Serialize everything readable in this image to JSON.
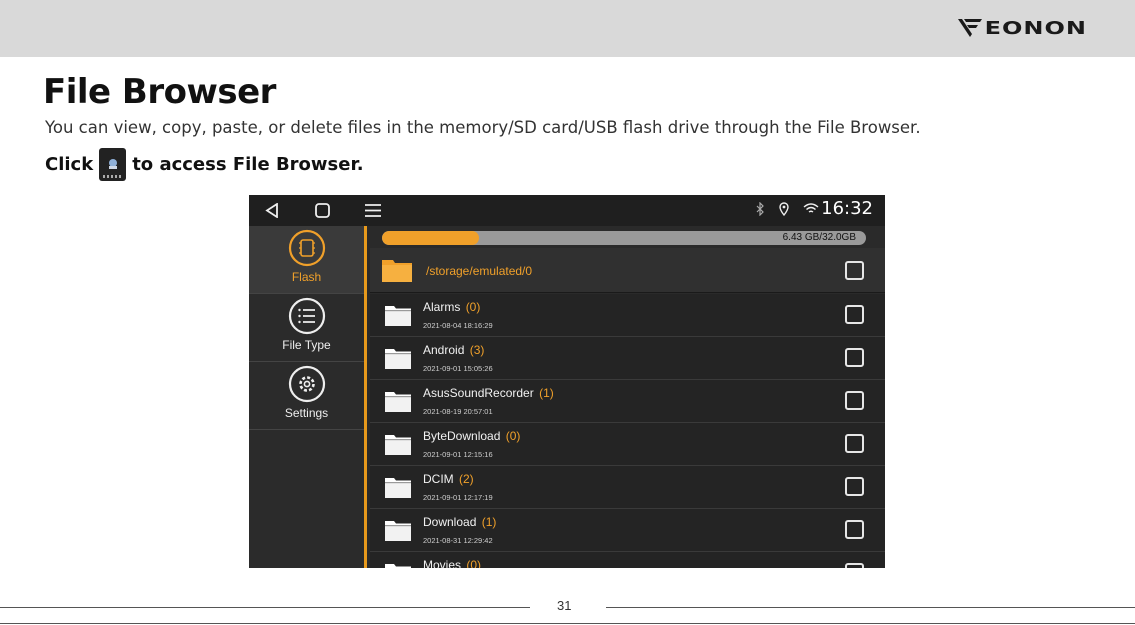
{
  "brand": {
    "name": "EONON",
    "logo_icon": "eonon-v-logo"
  },
  "document": {
    "title": "File Browser",
    "intro": "You can view, copy, paste, or delete files in the memory/SD card/USB flash drive through the File Browser.",
    "instruction_prefix": "Click",
    "instruction_suffix": "to access File Browser.",
    "instruction_icon": "file-browser-app-icon",
    "page_number": "31"
  },
  "screen": {
    "status_bar": {
      "nav_icons": [
        "back-icon",
        "home-icon",
        "menu-icon"
      ],
      "status_icons": [
        "bluetooth-icon",
        "location-icon",
        "wifi-icon"
      ],
      "time": "16:32"
    },
    "sidebar": {
      "items": [
        {
          "label": "Flash",
          "icon": "chip-icon",
          "active": true
        },
        {
          "label": "File Type",
          "icon": "list-icon",
          "active": false
        },
        {
          "label": "Settings",
          "icon": "gear-icon",
          "active": false
        }
      ]
    },
    "storage": {
      "used_fraction": 0.2,
      "label": "6.43 GB/32.0GB"
    },
    "current_path": "/storage/emulated/0",
    "files": [
      {
        "name": "Alarms",
        "count": "(0)",
        "date": "2021-08-04 18:16:29"
      },
      {
        "name": "Android",
        "count": "(3)",
        "date": "2021-09-01 15:05:26"
      },
      {
        "name": "AsusSoundRecorder",
        "count": "(1)",
        "date": "2021-08-19 20:57:01"
      },
      {
        "name": "ByteDownload",
        "count": "(0)",
        "date": "2021-09-01 12:15:16"
      },
      {
        "name": "DCIM",
        "count": "(2)",
        "date": "2021-09-01 12:17:19"
      },
      {
        "name": "Download",
        "count": "(1)",
        "date": "2021-08-31 12:29:42"
      },
      {
        "name": "Movies",
        "count": "(0)",
        "date": ""
      }
    ],
    "fab_label": "+",
    "accent_color": "#f0a02a"
  }
}
